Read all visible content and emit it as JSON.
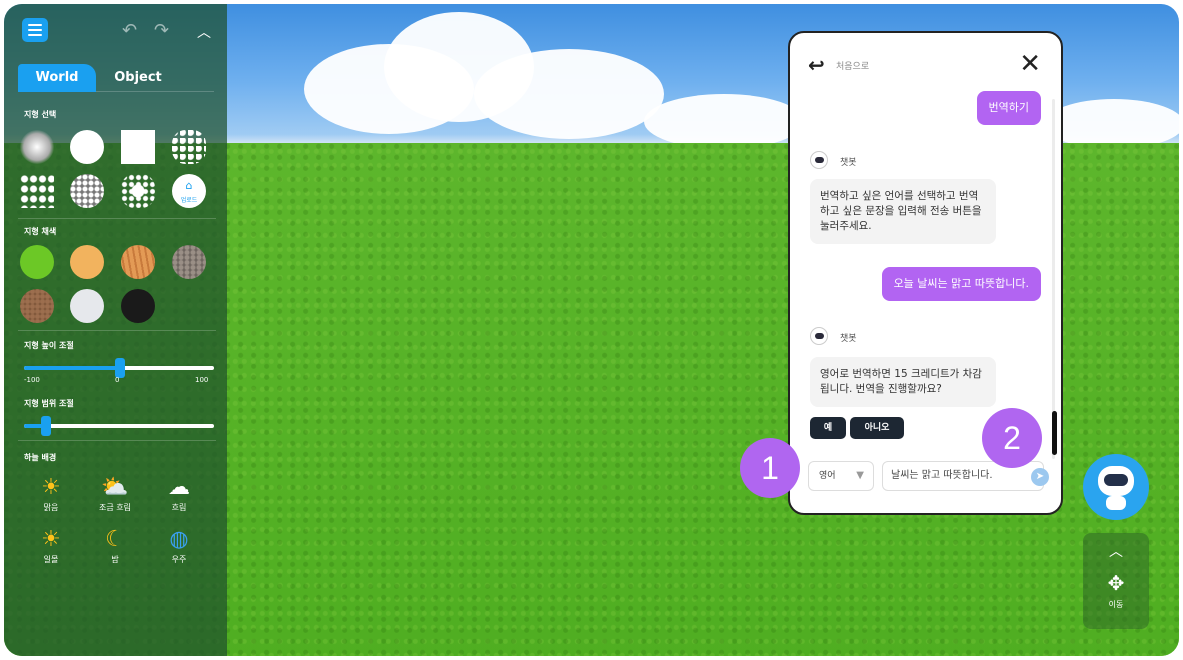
{
  "panel": {
    "tabs": [
      "World",
      "Object"
    ],
    "sections": {
      "terrain_select": "지형 선택",
      "terrain_color": "지형 채색",
      "terrain_height": "지형 높이 조절",
      "terrain_range": "지형 범위 조절",
      "sky": "하늘 배경"
    },
    "shape_upload_label": "업로드",
    "height_slider": {
      "min": "-100",
      "mid": "0",
      "max": "100",
      "value": 0
    },
    "range_slider_value": 0.12,
    "sky_items": [
      "맑음",
      "조금 흐림",
      "흐림",
      "일몰",
      "밤",
      "우주"
    ]
  },
  "chat": {
    "back_label": "처음으로",
    "user_msg_1": "번역하기",
    "bot_name": "챗봇",
    "bot_msg_1": "번역하고 싶은 언어를 선택하고 번역하고 싶은 문장을 입력해 전송 버튼을 눌러주세요.",
    "user_msg_2": "오늘 날씨는 맑고 따뜻합니다.",
    "bot_msg_2": "영어로 번역하면 15 크레디트가 차감됩니다. 번역을 진행할까요?",
    "yes_label": "예",
    "no_label": "아니오",
    "language_selected": "영어",
    "input_value": "날씨는 맑고 따뜻합니다."
  },
  "badges": [
    "1",
    "2"
  ],
  "move_label": "이동",
  "colors": {
    "accent": "#1aa0f0",
    "purple": "#b264f2",
    "badge": "#b066f0"
  }
}
